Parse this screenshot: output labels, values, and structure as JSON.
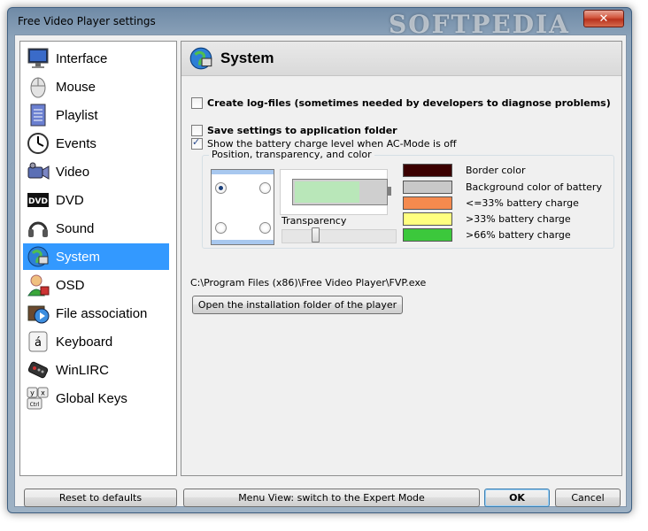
{
  "window": {
    "title": "Free Video Player settings",
    "watermark": "SOFTPEDIA"
  },
  "sidebar": {
    "items": [
      {
        "label": "Interface",
        "icon": "monitor-icon"
      },
      {
        "label": "Mouse",
        "icon": "mouse-icon"
      },
      {
        "label": "Playlist",
        "icon": "playlist-icon"
      },
      {
        "label": "Events",
        "icon": "clock-icon"
      },
      {
        "label": "Video",
        "icon": "video-camera-icon"
      },
      {
        "label": "DVD",
        "icon": "dvd-icon"
      },
      {
        "label": "Sound",
        "icon": "headphones-icon"
      },
      {
        "label": "System",
        "icon": "system-globe-icon",
        "selected": true
      },
      {
        "label": "OSD",
        "icon": "osd-user-icon"
      },
      {
        "label": "File association",
        "icon": "file-association-icon"
      },
      {
        "label": "Keyboard",
        "icon": "keyboard-key-icon"
      },
      {
        "label": "WinLIRC",
        "icon": "remote-control-icon"
      },
      {
        "label": "Global Keys",
        "icon": "global-keys-icon"
      }
    ]
  },
  "section": {
    "title": "System"
  },
  "options": {
    "create_log": {
      "label": "Create log-files (sometimes needed by developers to diagnose problems)",
      "checked": false
    },
    "save_to_app_folder": {
      "label": "Save settings to application folder",
      "checked": false
    },
    "show_battery": {
      "label": "Show the battery charge level when AC-Mode is off",
      "checked": true
    }
  },
  "battery": {
    "group_label": "Position, transparency, and color",
    "position": "top-left",
    "transparency_label": "Transparency",
    "transparency_level": 0.28,
    "preview_fill": 0.72,
    "colors": [
      {
        "label": "Border color",
        "color": "#3b0000"
      },
      {
        "label": "Background color of battery",
        "color": "#c8c8c8"
      },
      {
        "label": "<=33% battery charge",
        "color": "#f58a4e"
      },
      {
        "label": ">33% battery charge",
        "color": "#ffff80"
      },
      {
        "label": ">66% battery charge",
        "color": "#3cc83c"
      }
    ]
  },
  "install": {
    "path": "C:\\Program Files (x86)\\Free Video Player\\FVP.exe",
    "open_folder_label": "Open the installation folder of the player"
  },
  "footer": {
    "reset_label": "Reset to defaults",
    "menu_view_label": "Menu View: switch to the Expert Mode",
    "ok_label": "OK",
    "cancel_label": "Cancel"
  }
}
